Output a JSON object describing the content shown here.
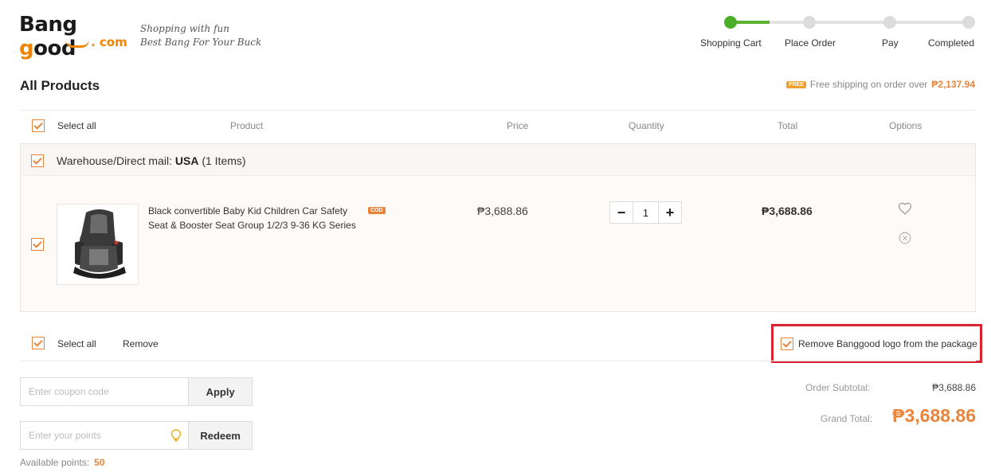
{
  "brand": {
    "logo_main": "Bang good",
    "logo_com": ". com",
    "slogan_line1": "Shopping with fun",
    "slogan_line2": "Best Bang For Your Buck"
  },
  "steps": [
    {
      "label": "Shopping Cart",
      "active": true
    },
    {
      "label": "Place Order",
      "active": false
    },
    {
      "label": "Pay",
      "active": false
    },
    {
      "label": "Completed",
      "active": false
    }
  ],
  "page_title": "All Products",
  "shipping": {
    "badge": "FREE",
    "text": "Free shipping on order over",
    "amount": "₱2,137.94"
  },
  "table_header": {
    "select_all": "Select all",
    "product": "Product",
    "price": "Price",
    "quantity": "Quantity",
    "total": "Total",
    "options": "Options"
  },
  "warehouse": {
    "label": "Warehouse/Direct mail:",
    "country": "USA",
    "count": "(1 Items)"
  },
  "item": {
    "name": "Black convertible Baby Kid Children Car Safety Seat & Booster Seat Group 1/2/3 9-36 KG Series",
    "badge": "COD",
    "price": "₱3,688.86",
    "quantity": "1",
    "total": "₱3,688.86",
    "checked": true
  },
  "icons": {
    "heart": "heart-icon",
    "remove": "close-circle-icon",
    "minus": "minus-icon",
    "plus": "plus-icon",
    "bulb": "lightbulb-icon"
  },
  "bottom_bar": {
    "select_all": "Select all",
    "remove": "Remove",
    "remove_logo": "Remove Banggood logo from the package"
  },
  "coupon": {
    "placeholder": "Enter coupon code",
    "button": "Apply"
  },
  "points": {
    "placeholder": "Enter your points",
    "button": "Redeem",
    "available_label": "Available points:",
    "available_value": "50"
  },
  "summary": {
    "subtotal_label": "Order Subtotal:",
    "subtotal_value": "₱3,688.86",
    "grand_label": "Grand Total:",
    "grand_value": "₱3,688.86"
  },
  "colors": {
    "accent": "#e8853b",
    "step_active": "#4caf29",
    "highlight_box": "#d9232d"
  }
}
